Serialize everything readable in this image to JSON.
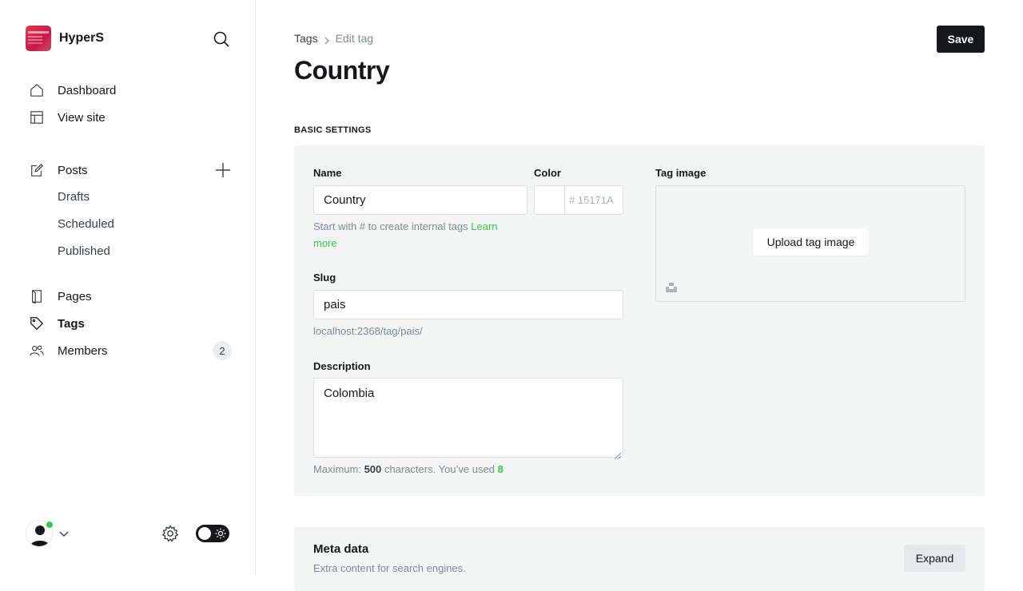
{
  "sidebar": {
    "brand": "HyperS",
    "nav": {
      "dashboard": "Dashboard",
      "view_site": "View site",
      "posts": "Posts",
      "drafts": "Drafts",
      "scheduled": "Scheduled",
      "published": "Published",
      "pages": "Pages",
      "tags": "Tags",
      "members": "Members",
      "members_count": "2"
    }
  },
  "header": {
    "breadcrumb_parent": "Tags",
    "breadcrumb_current": "Edit tag",
    "save_label": "Save",
    "title": "Country"
  },
  "basic_settings": {
    "section_label": "BASIC SETTINGS",
    "name_label": "Name",
    "name_value": "Country",
    "name_hint": "Start with # to create internal tags",
    "name_hint_link": "Learn more",
    "color_label": "Color",
    "color_prefix": "#",
    "color_placeholder": "15171A",
    "slug_label": "Slug",
    "slug_value": "pais",
    "slug_url": "localhost:2368/tag/pais/",
    "description_label": "Description",
    "description_value": "Colombia",
    "desc_hint_prefix": "Maximum:",
    "desc_hint_max": "500",
    "desc_hint_mid": "characters. You’ve used",
    "desc_hint_used": "8",
    "tag_image_label": "Tag image",
    "upload_label": "Upload tag image"
  },
  "meta_data": {
    "title": "Meta data",
    "subtitle": "Extra content for search engines.",
    "expand_label": "Expand"
  }
}
